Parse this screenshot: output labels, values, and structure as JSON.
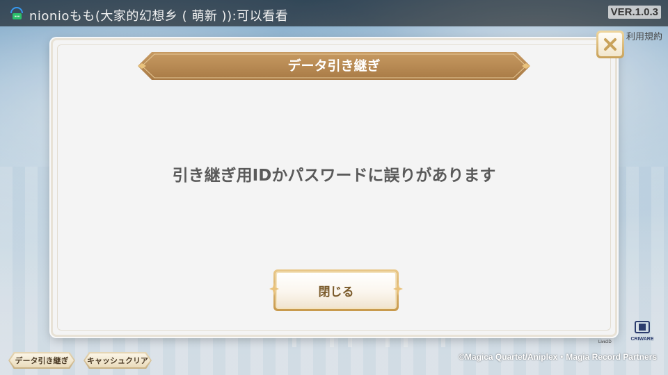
{
  "stream_banner": {
    "text": "nionioもも(大家的幻想乡 ( 萌新 )):可以看看"
  },
  "version": "VER.1.0.3",
  "terms_link": "利用規約",
  "dialog": {
    "title": "データ引き継ぎ",
    "message": "引き継ぎ用IDかパスワードに誤りがあります",
    "close_button_label": "閉じる"
  },
  "bottom_buttons": {
    "data_transfer": "データ引き継ぎ",
    "cache_clear": "キャッシュクリア"
  },
  "copyright": "©Magica Quartet/Aniplex・Magia Record Partners",
  "logos": {
    "cri": "CRIWARE",
    "live2d": "Live2D"
  },
  "colors": {
    "ribbon": "#b98a52",
    "button_text": "#7a5a2a",
    "message_text": "#5a5a5a",
    "gold_border": "#c89a4d"
  }
}
